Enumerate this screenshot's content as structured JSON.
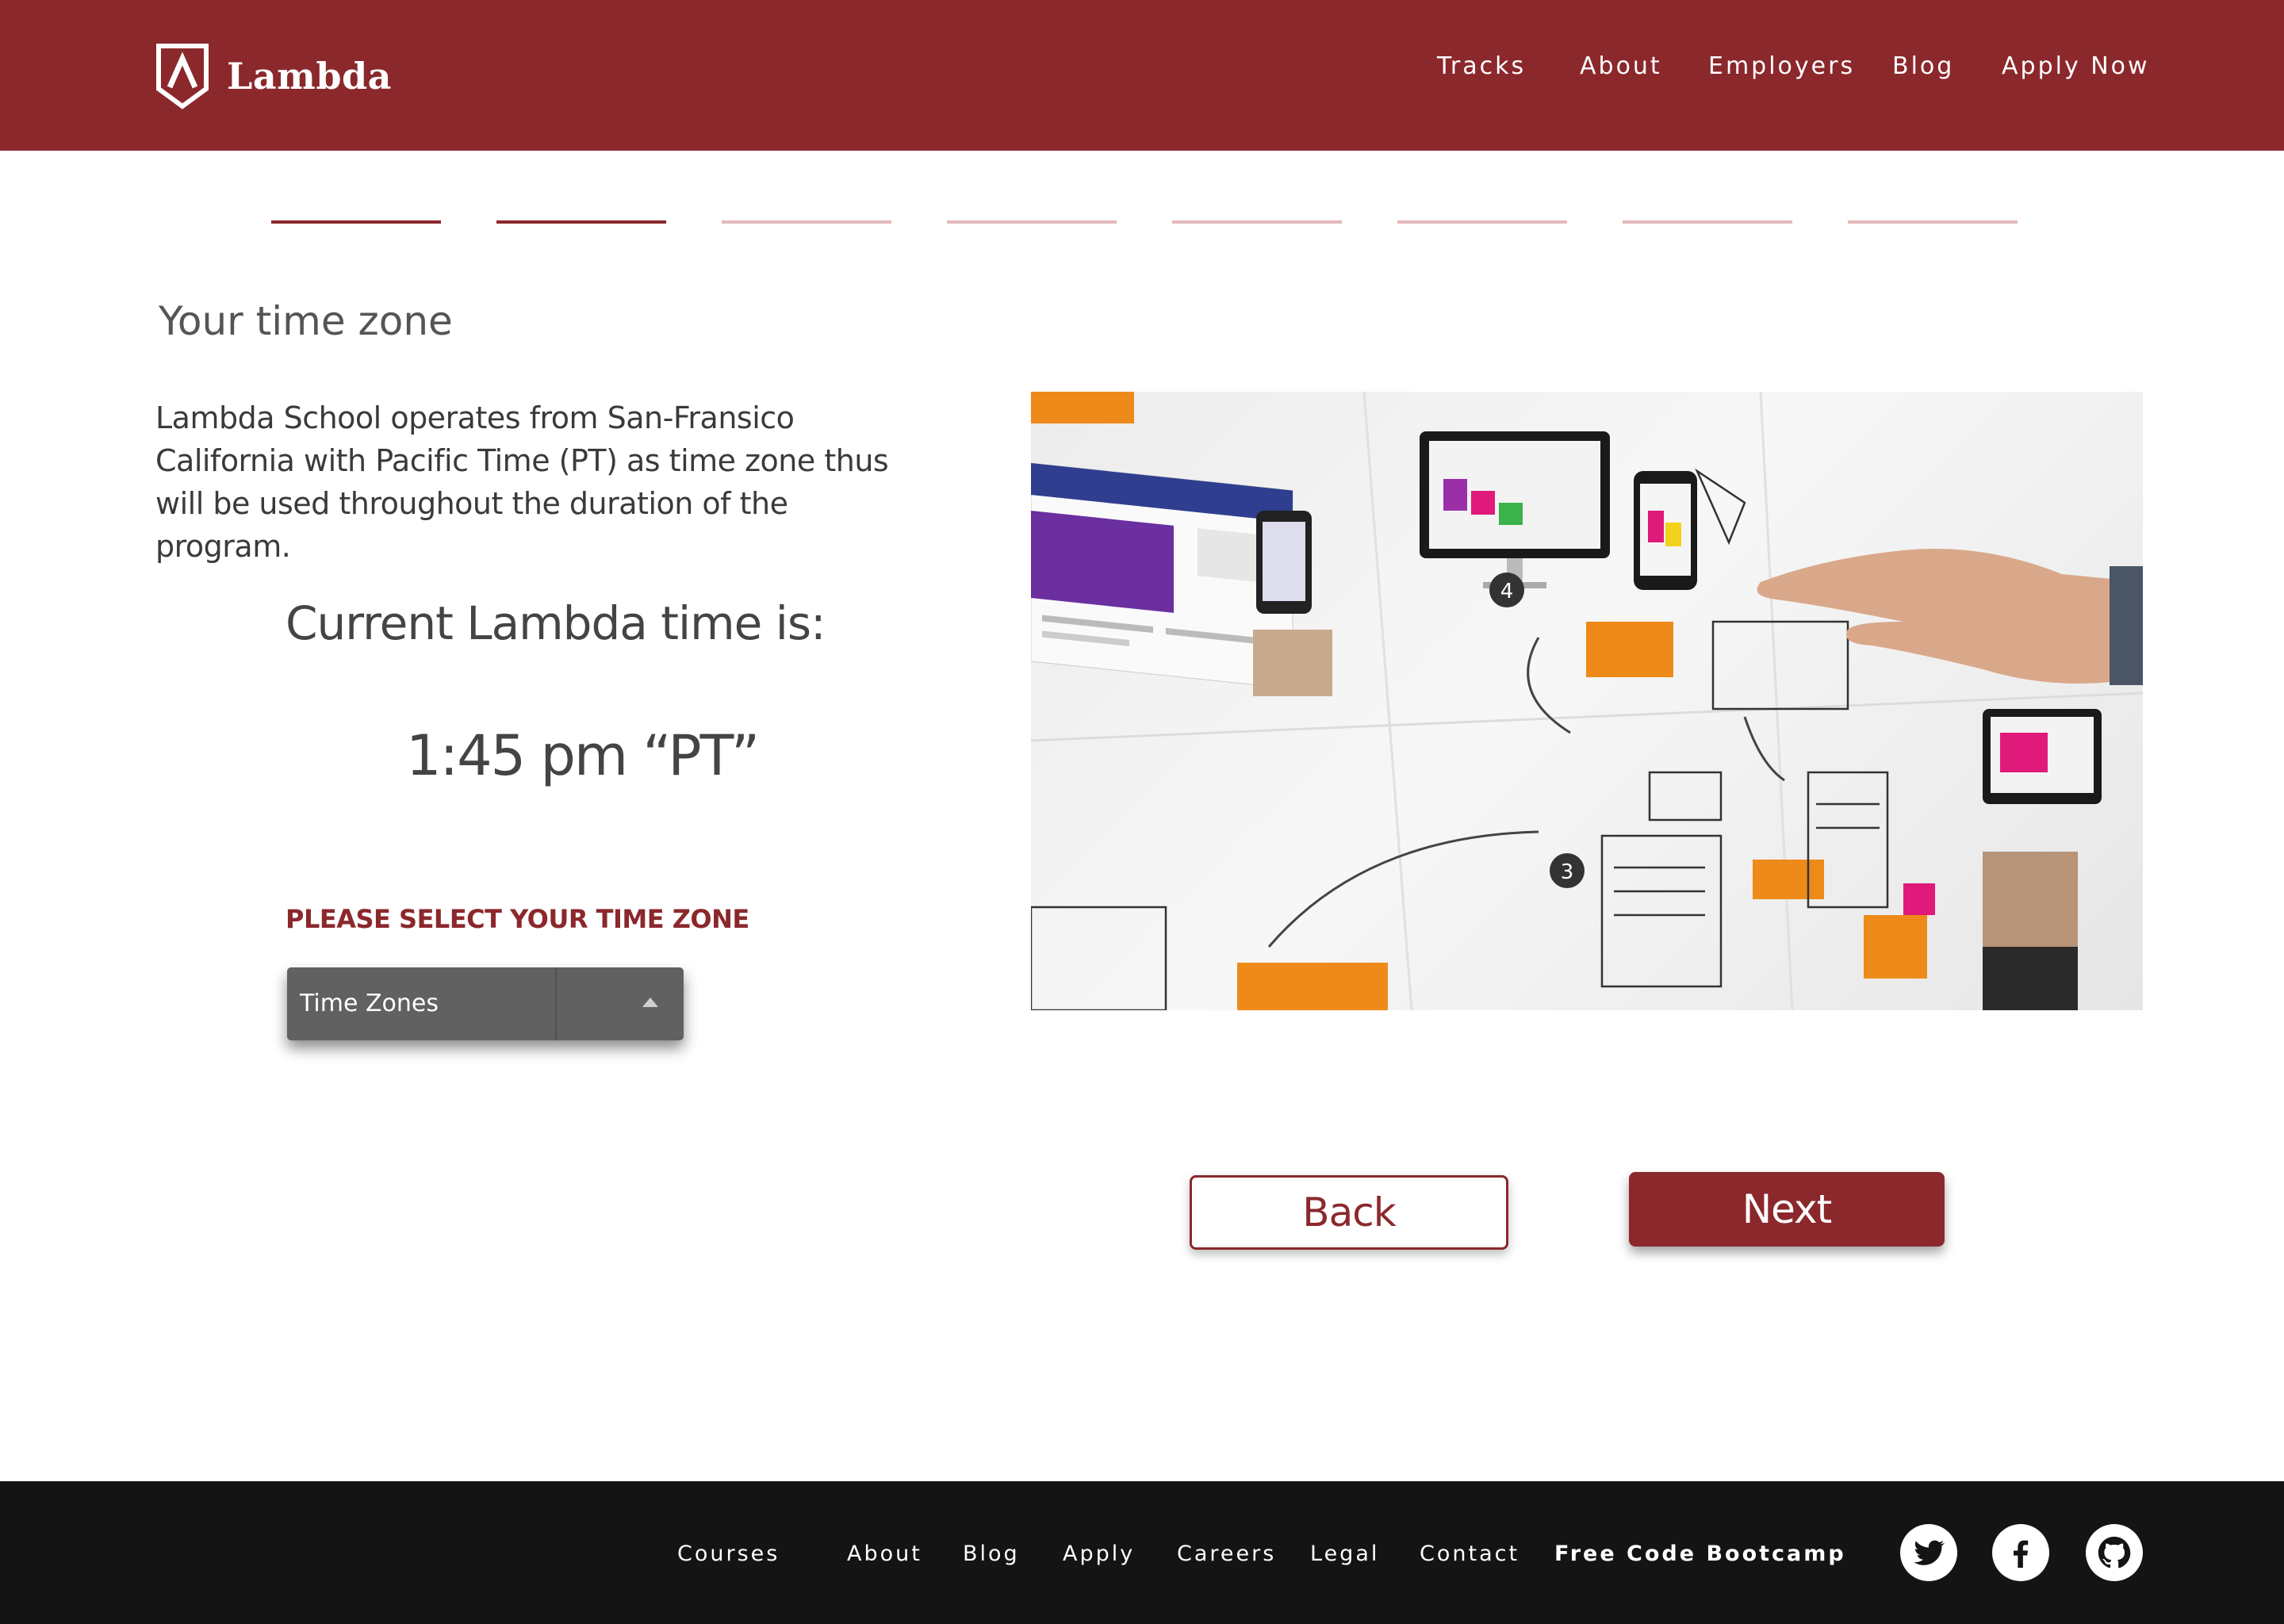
{
  "brand": {
    "name": "Lambda",
    "primary_color": "#8b282c",
    "footer_color": "#141414"
  },
  "nav": {
    "items": [
      {
        "label": "Tracks"
      },
      {
        "label": "About"
      },
      {
        "label": "Employers"
      },
      {
        "label": "Blog"
      },
      {
        "label": "Apply Now"
      }
    ]
  },
  "progress": {
    "total_steps": 8,
    "completed_steps": 2
  },
  "main": {
    "title": "Your time zone",
    "description": "Lambda School operates from San-Fransico California with Pacific Time (PT) as time zone thus will be used throughout the duration of the program.",
    "current_label": "Current Lambda time is:",
    "current_time": "1:45 pm “PT”",
    "select_label": "PLEASE SELECT YOUR TIME ZONE",
    "select_value": "Time Zones"
  },
  "buttons": {
    "back": "Back",
    "next": "Next"
  },
  "footer": {
    "links": [
      {
        "label": "Courses"
      },
      {
        "label": "About"
      },
      {
        "label": "Blog"
      },
      {
        "label": "Apply"
      },
      {
        "label": "Careers"
      },
      {
        "label": "Legal"
      },
      {
        "label": "Contact"
      },
      {
        "label": "Free Code Bootcamp"
      }
    ],
    "social": [
      "twitter-icon",
      "facebook-icon",
      "github-icon"
    ]
  }
}
